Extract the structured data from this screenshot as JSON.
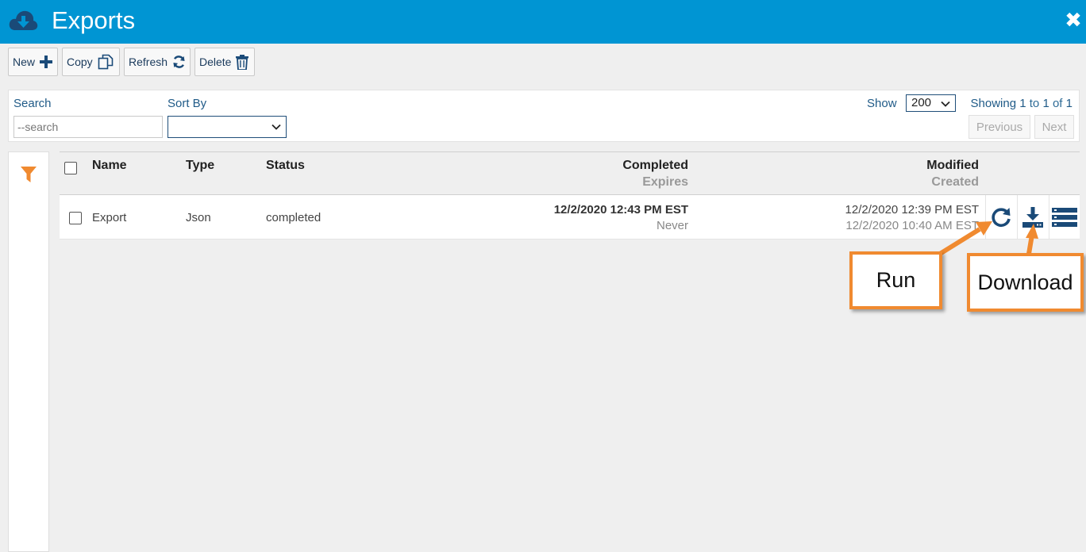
{
  "header": {
    "title": "Exports",
    "close_glyph": "✖"
  },
  "toolbar": {
    "new_label": "New",
    "copy_label": "Copy",
    "refresh_label": "Refresh",
    "delete_label": "Delete"
  },
  "filters": {
    "search_label": "Search",
    "search_placeholder": "--search",
    "search_value": "",
    "sort_label": "Sort By",
    "sort_value": "",
    "show_label": "Show",
    "show_value": "200",
    "showing_prefix": "Showing ",
    "showing_from": "1",
    "showing_to_word": " to ",
    "showing_to": "1",
    "showing_of_word": " of ",
    "showing_total": "1",
    "previous_label": "Previous",
    "next_label": "Next"
  },
  "table": {
    "columns": {
      "name": "Name",
      "type": "Type",
      "status": "Status",
      "completed": "Completed",
      "expires": "Expires",
      "modified": "Modified",
      "created": "Created"
    },
    "rows": [
      {
        "name": "Export",
        "type": "Json",
        "status": "completed",
        "completed": "12/2/2020 12:43 PM EST",
        "expires": "Never",
        "modified": "12/2/2020 12:39 PM EST",
        "created": "12/2/2020 10:40 AM EST"
      }
    ]
  },
  "callouts": {
    "run": "Run",
    "download": "Download"
  },
  "icons": {
    "app": "cloud-download-icon",
    "close": "close-icon",
    "new": "plus-icon",
    "copy": "copy-icon",
    "refresh": "refresh-icon",
    "delete": "trash-icon",
    "filter": "filter-icon",
    "run": "run-icon",
    "download": "download-icon",
    "details": "list-icon"
  },
  "colors": {
    "header": "#0095d3",
    "icon_navy": "#1a4a78",
    "accent_orange": "#f08a30"
  }
}
